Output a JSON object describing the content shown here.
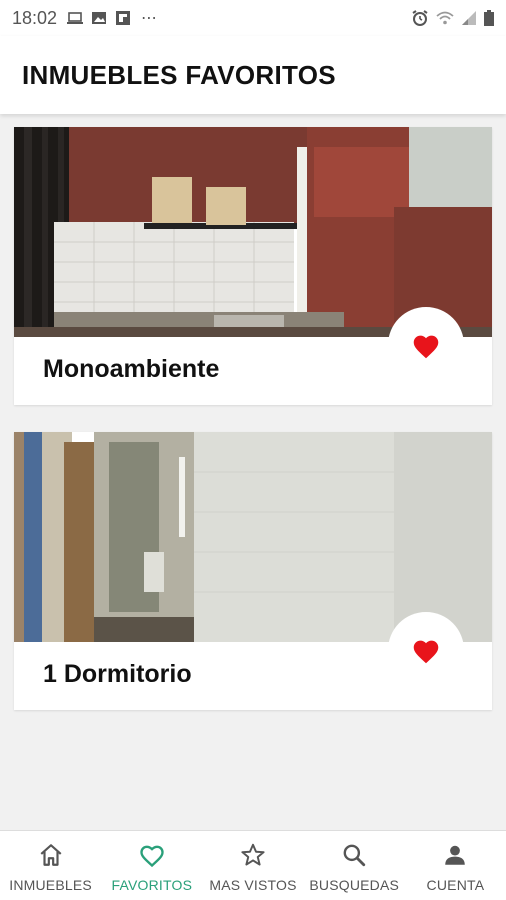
{
  "status_bar": {
    "time": "18:02",
    "more": "⋯"
  },
  "app_bar": {
    "title": "INMUEBLES FAVORITOS"
  },
  "listings": [
    {
      "title": "Monoambiente",
      "favorited": true
    },
    {
      "title": "1 Dormitorio",
      "favorited": true
    }
  ],
  "bottom_nav": {
    "items": [
      {
        "label": "INMUEBLES",
        "icon": "home-icon",
        "active": false
      },
      {
        "label": "FAVORITOS",
        "icon": "heart-outline-icon",
        "active": true
      },
      {
        "label": "MAS VISTOS",
        "icon": "star-icon",
        "active": false
      },
      {
        "label": "BUSQUEDAS",
        "icon": "search-icon",
        "active": false
      },
      {
        "label": "CUENTA",
        "icon": "person-icon",
        "active": false
      }
    ]
  },
  "colors": {
    "accent": "#2aa07a",
    "favorite": "#e8141b",
    "background": "#f1f1f1"
  }
}
